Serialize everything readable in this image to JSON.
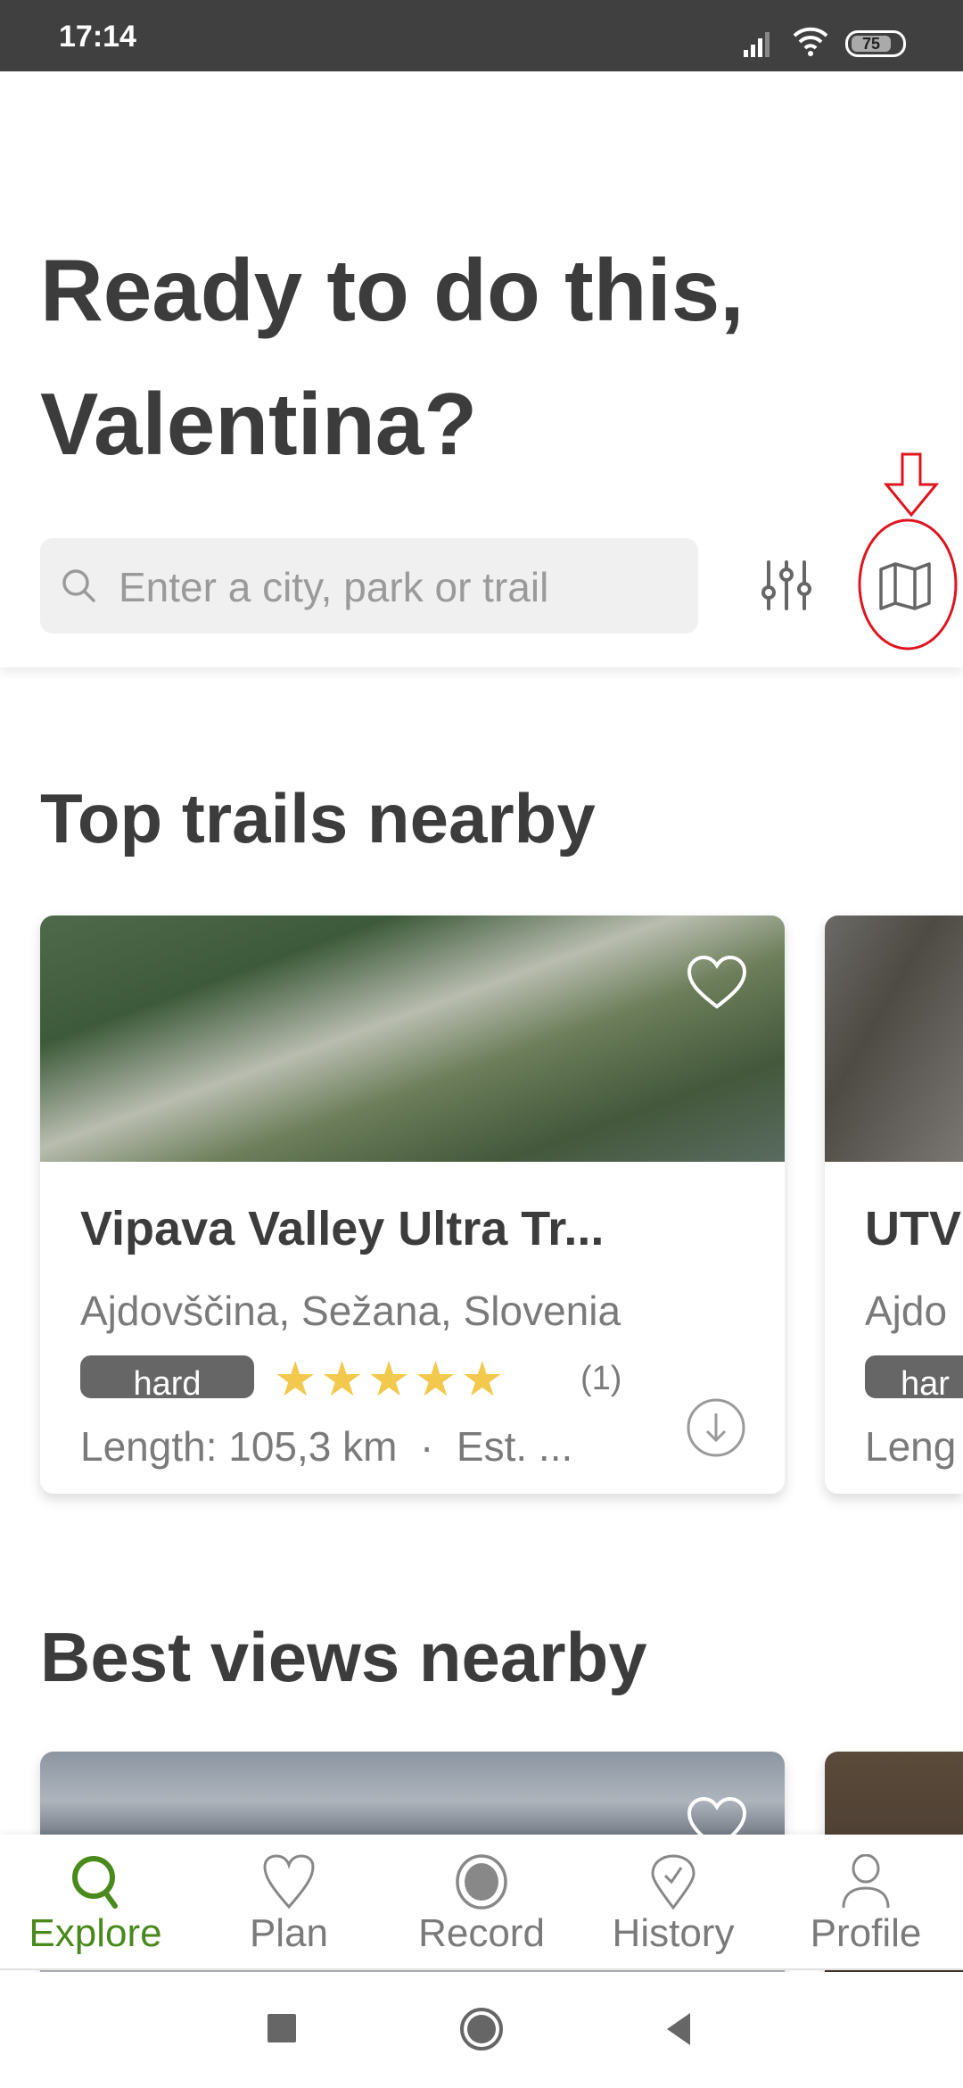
{
  "status_bar": {
    "time": "17:14",
    "battery": "75"
  },
  "header": {
    "greeting_line1": "Ready to do this,",
    "greeting_line2": "Valentina?",
    "search_placeholder": "Enter a city, park or trail",
    "filter_icon": "sliders-icon",
    "map_icon": "map-icon",
    "annotation_color": "#e0141e"
  },
  "sections": [
    {
      "title": "Top trails nearby",
      "cards": [
        {
          "title": "Vipava Valley Ultra Tr...",
          "location": "Ajdovščina, Sežana, Slovenia",
          "difficulty": "hard",
          "rating": 5,
          "stars": "★★★★★",
          "review_count": "(1)",
          "length": "Length: 105,3 km  ·  Est. ..."
        },
        {
          "title": "UTV",
          "location": "Ajdo",
          "difficulty": "har",
          "length": "Leng"
        }
      ]
    },
    {
      "title": "Best views nearby"
    }
  ],
  "bottom_nav": {
    "active_color": "#4a8a1c",
    "items": [
      {
        "label": "Explore",
        "icon": "search-icon",
        "active": true
      },
      {
        "label": "Plan",
        "icon": "heart-icon"
      },
      {
        "label": "Record",
        "icon": "record-icon"
      },
      {
        "label": "History",
        "icon": "history-pin-icon"
      },
      {
        "label": "Profile",
        "icon": "person-icon"
      }
    ]
  }
}
